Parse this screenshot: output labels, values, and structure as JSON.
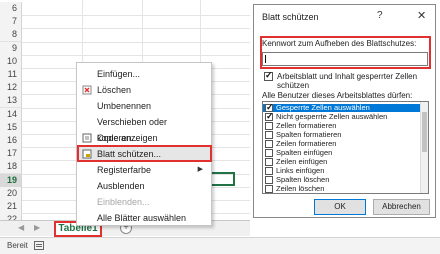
{
  "grid": {
    "rows": [
      "6",
      "7",
      "8",
      "9",
      "10",
      "11",
      "12",
      "13",
      "14",
      "15",
      "16",
      "17",
      "18",
      "19",
      "20",
      "21",
      "22"
    ],
    "active_row": "19"
  },
  "sheet_tab": {
    "label": "Tabelle1"
  },
  "status": {
    "text": "Bereit"
  },
  "context_menu": {
    "items": [
      {
        "label": "Einfügen...",
        "disabled": false
      },
      {
        "label": "Löschen",
        "disabled": false
      },
      {
        "label": "Umbenennen",
        "disabled": false
      },
      {
        "label": "Verschieben oder kopieren...",
        "disabled": false
      },
      {
        "label": "Code anzeigen",
        "disabled": false
      },
      {
        "label": "Blatt schützen...",
        "disabled": false,
        "highlighted": true
      },
      {
        "label": "Registerfarbe",
        "disabled": false,
        "submenu": true
      },
      {
        "label": "Ausblenden",
        "disabled": false
      },
      {
        "label": "Einblenden...",
        "disabled": true
      },
      {
        "label": "Alle Blätter auswählen",
        "disabled": false
      }
    ]
  },
  "dialog": {
    "title": "Blatt schützen",
    "help": "?",
    "close": "✕",
    "password_label": "Kennwort zum Aufheben des Blattschutzes:",
    "password_value": "",
    "protect_checkbox_label": "Arbeitsblatt und Inhalt gesperrter Zellen schützen",
    "protect_checked": true,
    "list_label": "Alle Benutzer dieses Arbeitsblattes dürfen:",
    "permissions": [
      {
        "label": "Gesperrte Zellen auswählen",
        "checked": true,
        "selected": true
      },
      {
        "label": "Nicht gesperrte Zellen auswählen",
        "checked": true,
        "selected": false
      },
      {
        "label": "Zellen formatieren",
        "checked": false,
        "selected": false
      },
      {
        "label": "Spalten formatieren",
        "checked": false,
        "selected": false
      },
      {
        "label": "Zeilen formatieren",
        "checked": false,
        "selected": false
      },
      {
        "label": "Spalten einfügen",
        "checked": false,
        "selected": false
      },
      {
        "label": "Zeilen einfügen",
        "checked": false,
        "selected": false
      },
      {
        "label": "Links einfügen",
        "checked": false,
        "selected": false
      },
      {
        "label": "Spalten löschen",
        "checked": false,
        "selected": false
      },
      {
        "label": "Zeilen löschen",
        "checked": false,
        "selected": false
      }
    ],
    "ok_label": "OK",
    "cancel_label": "Abbrechen"
  },
  "colors": {
    "highlight_red": "#e03030",
    "excel_green": "#217346",
    "selection_blue": "#0078d7"
  }
}
